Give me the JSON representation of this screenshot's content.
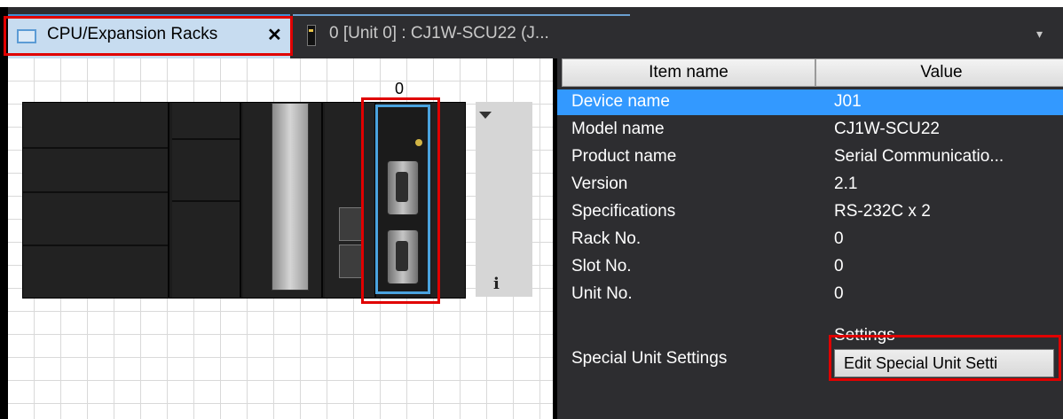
{
  "tabs": [
    {
      "label": "CPU/Expansion Racks",
      "close": "✕",
      "active": true
    },
    {
      "label": "0 [Unit 0] : CJ1W-SCU22 (J...",
      "active": false
    }
  ],
  "tab_dropdown": "▾",
  "rack": {
    "slot_label": "0",
    "info_glyph": "i"
  },
  "properties": {
    "columns": [
      "Item name",
      "Value"
    ],
    "rows": [
      {
        "name": "Device name",
        "value": "J01",
        "selected": true
      },
      {
        "name": "Model name",
        "value": "CJ1W-SCU22"
      },
      {
        "name": "Product name",
        "value": "Serial Communicatio..."
      },
      {
        "name": "Version",
        "value": "2.1"
      },
      {
        "name": "Specifications",
        "value": "RS-232C x 2"
      },
      {
        "name": "Rack No.",
        "value": "0"
      },
      {
        "name": "Slot No.",
        "value": "0"
      },
      {
        "name": "Unit No.",
        "value": "0"
      }
    ],
    "special": {
      "name": "Special Unit Settings",
      "settings_label": "Settings",
      "button": "Edit Special Unit Setti"
    }
  },
  "colors": {
    "selection": "#3399ff",
    "active_tab": "#c7dcf0",
    "highlight": "#e00000",
    "module_outline": "#4aa3df"
  }
}
